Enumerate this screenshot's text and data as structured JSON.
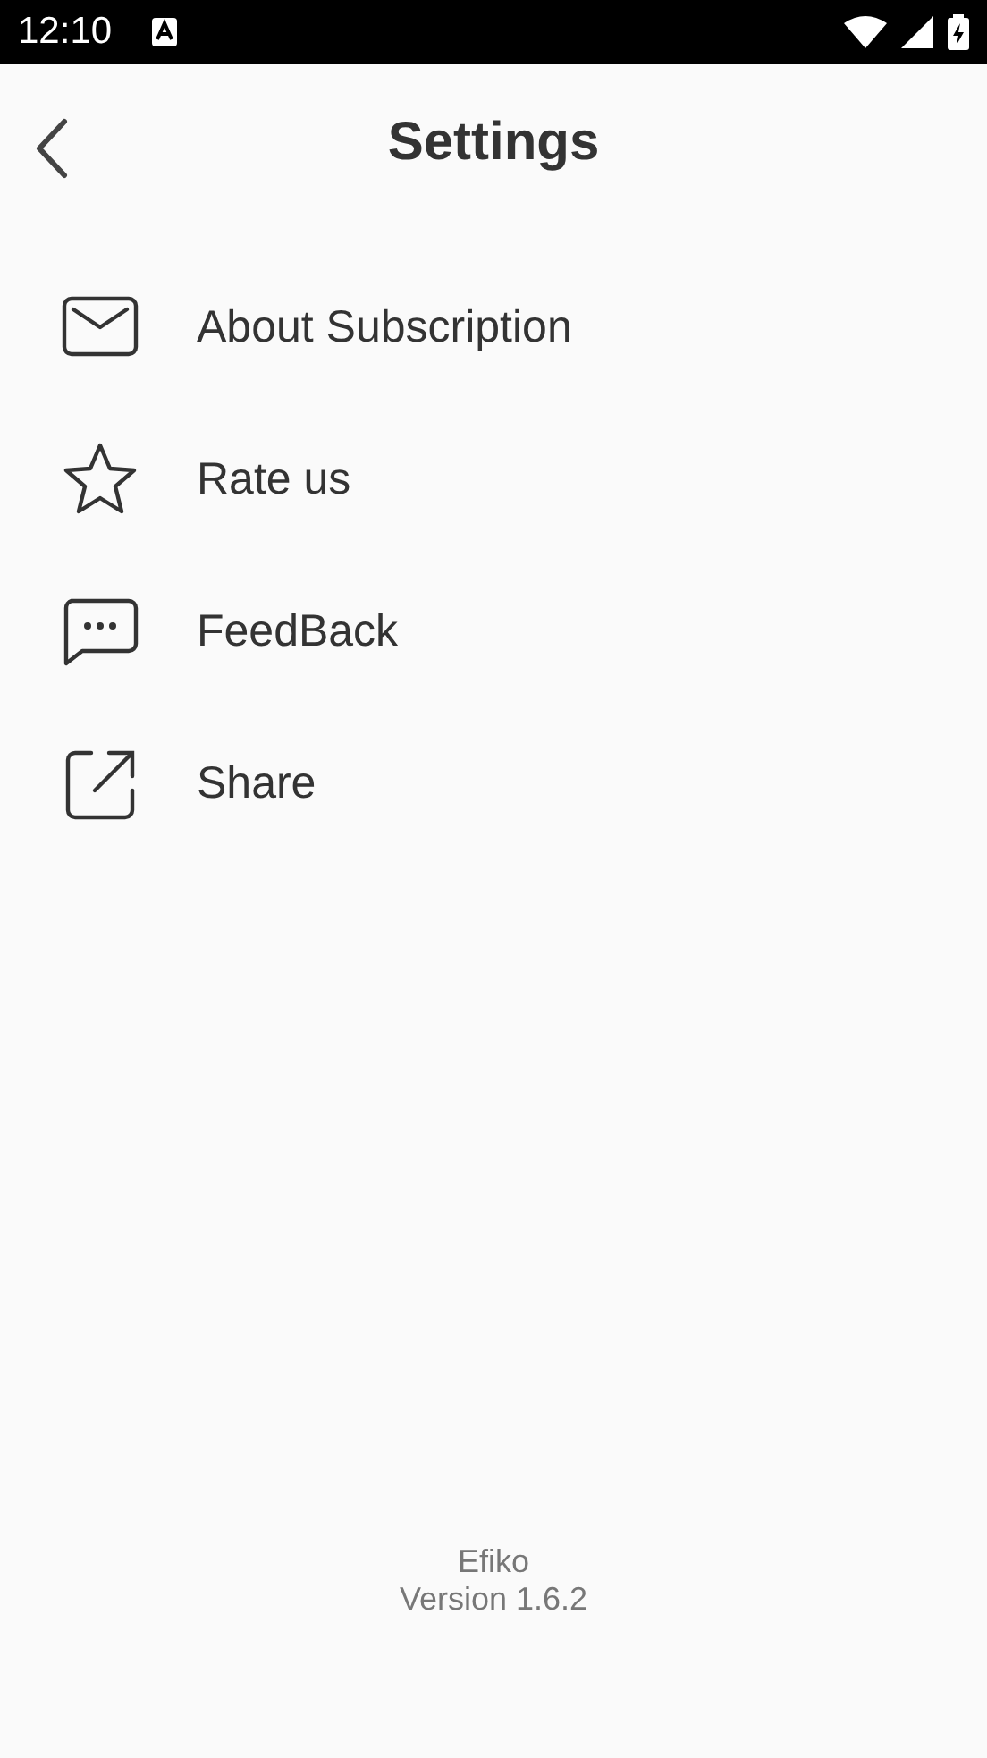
{
  "status_bar": {
    "time": "12:10"
  },
  "header": {
    "title": "Settings"
  },
  "items": [
    {
      "label": "About Subscription"
    },
    {
      "label": "Rate us"
    },
    {
      "label": "FeedBack"
    },
    {
      "label": "Share"
    }
  ],
  "footer": {
    "app_name": "Efiko",
    "version": "Version 1.6.2"
  }
}
